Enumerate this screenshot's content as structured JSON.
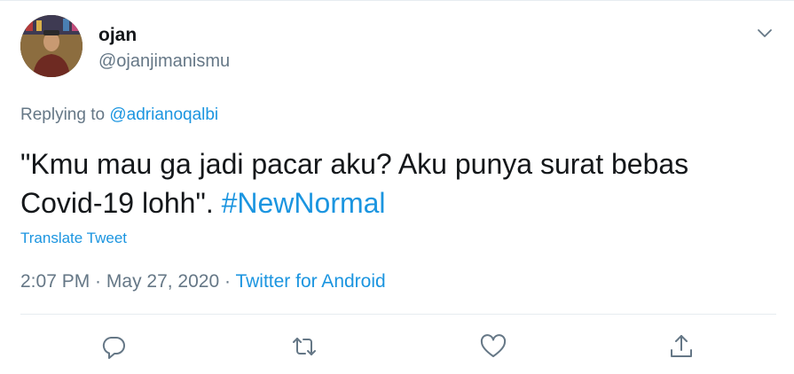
{
  "author": {
    "display_name": "ojan",
    "handle": "@ojanjimanismu"
  },
  "reply": {
    "prefix": "Replying to ",
    "mention": "@adrianoqalbi"
  },
  "tweet": {
    "text": "\"Kmu mau ga jadi pacar aku? Aku punya surat bebas Covid-19 lohh\". ",
    "hashtag": "#NewNormal"
  },
  "translate_label": "Translate Tweet",
  "meta": {
    "time": "2:07 PM",
    "separator1": " · ",
    "date": "May 27, 2020",
    "separator2": " · ",
    "source": "Twitter for Android"
  },
  "colors": {
    "link": "#1b95e0",
    "secondary_text": "#657786",
    "icon": "#657786"
  },
  "icons": {
    "menu": "chevron-down-icon",
    "reply": "reply-icon",
    "retweet": "retweet-icon",
    "like": "heart-icon",
    "share": "share-icon"
  }
}
